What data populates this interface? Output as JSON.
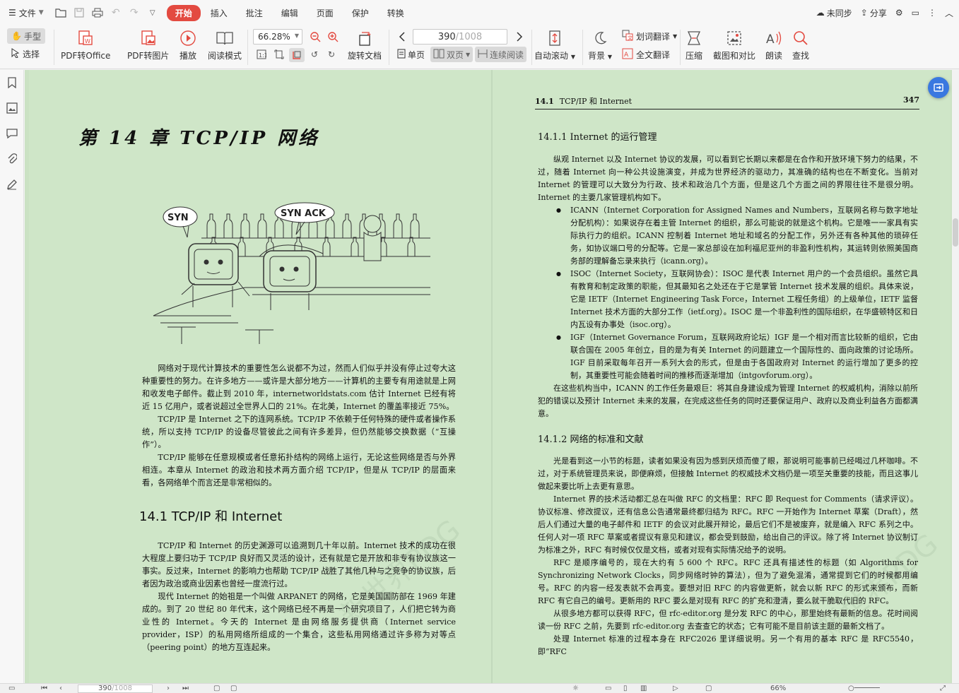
{
  "menubar": {
    "file_label": "文件",
    "tabs": [
      {
        "label": "开始",
        "active": true
      },
      {
        "label": "插入",
        "active": false
      },
      {
        "label": "批注",
        "active": false
      },
      {
        "label": "编辑",
        "active": false
      },
      {
        "label": "页面",
        "active": false
      },
      {
        "label": "保护",
        "active": false
      },
      {
        "label": "转换",
        "active": false
      }
    ],
    "sync_label": "未同步",
    "share_label": "分享"
  },
  "toolbar": {
    "hand_label": "手型",
    "select_label": "选择",
    "pdf_to_office": "PDF转Office",
    "pdf_to_image": "PDF转图片",
    "play": "播放",
    "read_mode": "阅读模式",
    "zoom_value": "66.28%",
    "rotate_doc": "旋转文档",
    "page_current": "390",
    "page_total": "/1008",
    "single_page": "单页",
    "double_page": "双页",
    "continuous": "连续阅读",
    "auto_scroll": "自动滚动",
    "background": "背景",
    "word_translate": "划词翻译",
    "full_translate": "全文翻译",
    "compress": "压缩",
    "screenshot_compare": "截图和对比",
    "read_aloud": "朗读",
    "find": "查找"
  },
  "left_page": {
    "chapter_title": "第 14 章   TCP/IP 网络",
    "illustration_labels": {
      "syn": "SYN",
      "synack": "SYN ACK"
    },
    "intro_paragraphs": [
      "网络对于现代计算技术的重要性怎么说都不为过，然而人们似乎并没有停止过夸大这种重要性的努力。在许多地方——或许是大部分地方——计算机的主要专有用途就是上网和收发电子邮件。截止到 2010 年，internetworldstats.com 估计 Internet 已经有将近 15 亿用户，或者说超过全世界人口的 21%。在北美，Internet 的覆盖率接近 75%。",
      "TCP/IP 是 Internet 之下的连网系统。TCP/IP 不依赖于任何特殊的硬件或者操作系统，所以支持 TCP/IP 的设备尽管彼此之间有许多差异，但仍然能够交换数据（“互操作”）。",
      "TCP/IP 能够在任意规模或者任意拓扑结构的网络上运行，无论这些网络是否与外界相连。本章从 Internet 的政治和技术两方面介绍 TCP/IP，但是从 TCP/IP 的层面来看，各网络单个而言还是非常相似的。"
    ],
    "section_title": "14.1   TCP/IP 和 Internet",
    "section_paragraphs": [
      "TCP/IP 和 Internet 的历史渊源可以追溯到几十年以前。Internet 技术的成功在很大程度上要归功于 TCP/IP 良好而又灵活的设计，还有就是它是开放和非专有协议族这一事实。反过来，Internet 的影响力也帮助 TCP/IP 战胜了其他几种与之竞争的协议族，后者因为政治或商业因素也曾经一度流行过。",
      "现代 Internet 的始祖是一个叫做 ARPANET 的网络，它是美国国防部在 1969 年建成的。到了 20 世纪 80 年代末，这个网络已经不再是一个研究项目了，人们把它转为商业性的 Internet。今天的 Internet 是由网络服务提供商（Internet service provider，ISP）的私用网络所组成的一个集合，这些私用网络通过许多称为对等点（peering point）的地方互连起来。"
    ]
  },
  "right_page": {
    "header_section": "14.1",
    "header_title": "TCP/IP 和 Internet",
    "page_number": "347",
    "sub1_title": "14.1.1   Internet 的运行管理",
    "sub1_intro": "纵观 Internet 以及 Internet 协议的发展，可以看到它长期以来都是在合作和开放环境下努力的结果，不过，随着 Internet 向一种公共设施演变，并成为世界经济的驱动力，其准确的结构也在不断变化。当前对 Internet 的管理可以大致分为行政、技术和政治几个方面，但是这几个方面之间的界限往往不是很分明。Internet 的主要几家管理机构如下。",
    "bullets": [
      "ICANN（Internet Corporation for Assigned Names and Numbers，互联网名称与数字地址分配机构）：如果说存在着主管 Internet 的组织，那么可能说的就是这个机构。它是唯一一家具有实际执行力的组织。ICANN 控制着 Internet 地址和域名的分配工作，另外还有各种其他的琐碎任务，如协议端口号的分配等。它是一家总部设在加利福尼亚州的非盈利性机构，其运转则依照美国商务部的理解备忘录来执行（icann.org）。",
      "ISOC（Internet Society，互联网协会）：ISOC 是代表 Internet 用户的一个会员组织。虽然它具有教育和制定政策的职能，但其最知名之处还在于它是掌管 Internet 技术发展的组织。具体来说，它是 IETF（Internet Engineering Task Force，Internet 工程任务组）的上级单位，IETF 监督 Internet 技术方面的大部分工作（ietf.org）。ISOC 是一个非盈利性的国际组织，在华盛顿特区和日内瓦设有办事处（isoc.org）。",
      "IGF（Internet Governance Forum，互联网政府论坛）IGF 是一个相对而言比较新的组织，它由联合国在 2005 年创立，目的是为有关 Internet 的问题建立一个国际性的、面向政策的讨论场所。IGF 目前采取每年召开一系列大会的形式，但是由于各国政府对 Internet 的运行增加了更多的控制，其重要性可能会随着时间的推移而逐渐增加（intgovforum.org）。"
    ],
    "sub1_outro": "在这些机构当中，ICANN 的工作任务最艰巨：将其自身建设成为管理 Internet 的权威机构，消除以前所犯的错误以及预计 Internet 未来的发展，在完成这些任务的同时还要保证用户、政府以及商业利益各方面都满意。",
    "sub2_title": "14.1.2   网络的标准和文献",
    "sub2_paragraphs": [
      "光是看到这一小节的标题，读者如果没有因为感到厌烦而傻了眼，那说明可能事前已经喝过几杯咖啡。不过，对于系统管理员来说，即便麻烦，但接触 Internet 的权威技术文档仍是一项至关重要的技能，而且这事儿做起来要比听上去更有意思。",
      "Internet 界的技术活动都汇总在叫做 RFC 的文档里：RFC 即 Request for Comments（请求评议）。协议标准、修改提议，还有信息公告通常最终都归结为 RFC。RFC 一开始作为 Internet 草案（Draft），然后人们通过大量的电子邮件和 IETF 的会议对此展开辩论，最后它们不是被废弃，就是编入 RFC 系列之中。任何人对一项 RFC 草案或者提议有意见和建议，都会受到鼓励，给出自己的评议。除了将 Internet 协议制订为标准之外，RFC 有时候仅仅是文档，或者对现有实际情况给予的说明。",
      "RFC 是顺序编号的，现在大约有 5 600 个 RFC。RFC 还具有描述性的标题（如 Algorithms for Synchronizing Network Clocks，同步网络时钟的算法），但为了避免混淆，通常提到它们的时候都用编号。RFC 的内容一经发表就不会再变。要想对旧 RFC 的内容做更新，就会以新 RFC 的形式来颁布，而新 RFC 有它自己的编号。更新用的 RFC 要么是对现有 RFC 的扩充和澄清，要么就干脆取代旧的 RFC。",
      "从很多地方都可以获得 RFC，但 rfc-editor.org 是分发 RFC 的中心，那里始终有最新的信息。花时间阅读一份 RFC 之前，先要到 rfc-editor.org 去查查它的状态；它有可能不是目前该主题的最新文档了。",
      "处理 Internet 标准的过程本身在 RFC2026 里详细说明。另一个有用的基本 RFC 是 RFC5540，即“RFC"
    ]
  },
  "watermark_text": "新世界PDG",
  "statusbar": {
    "page_current": "390",
    "page_total": "/1008",
    "zoom": "66%"
  },
  "colors": {
    "accent": "#e34a40",
    "page_bg": "#cfe6c8",
    "float_button": "#3a78e0"
  }
}
